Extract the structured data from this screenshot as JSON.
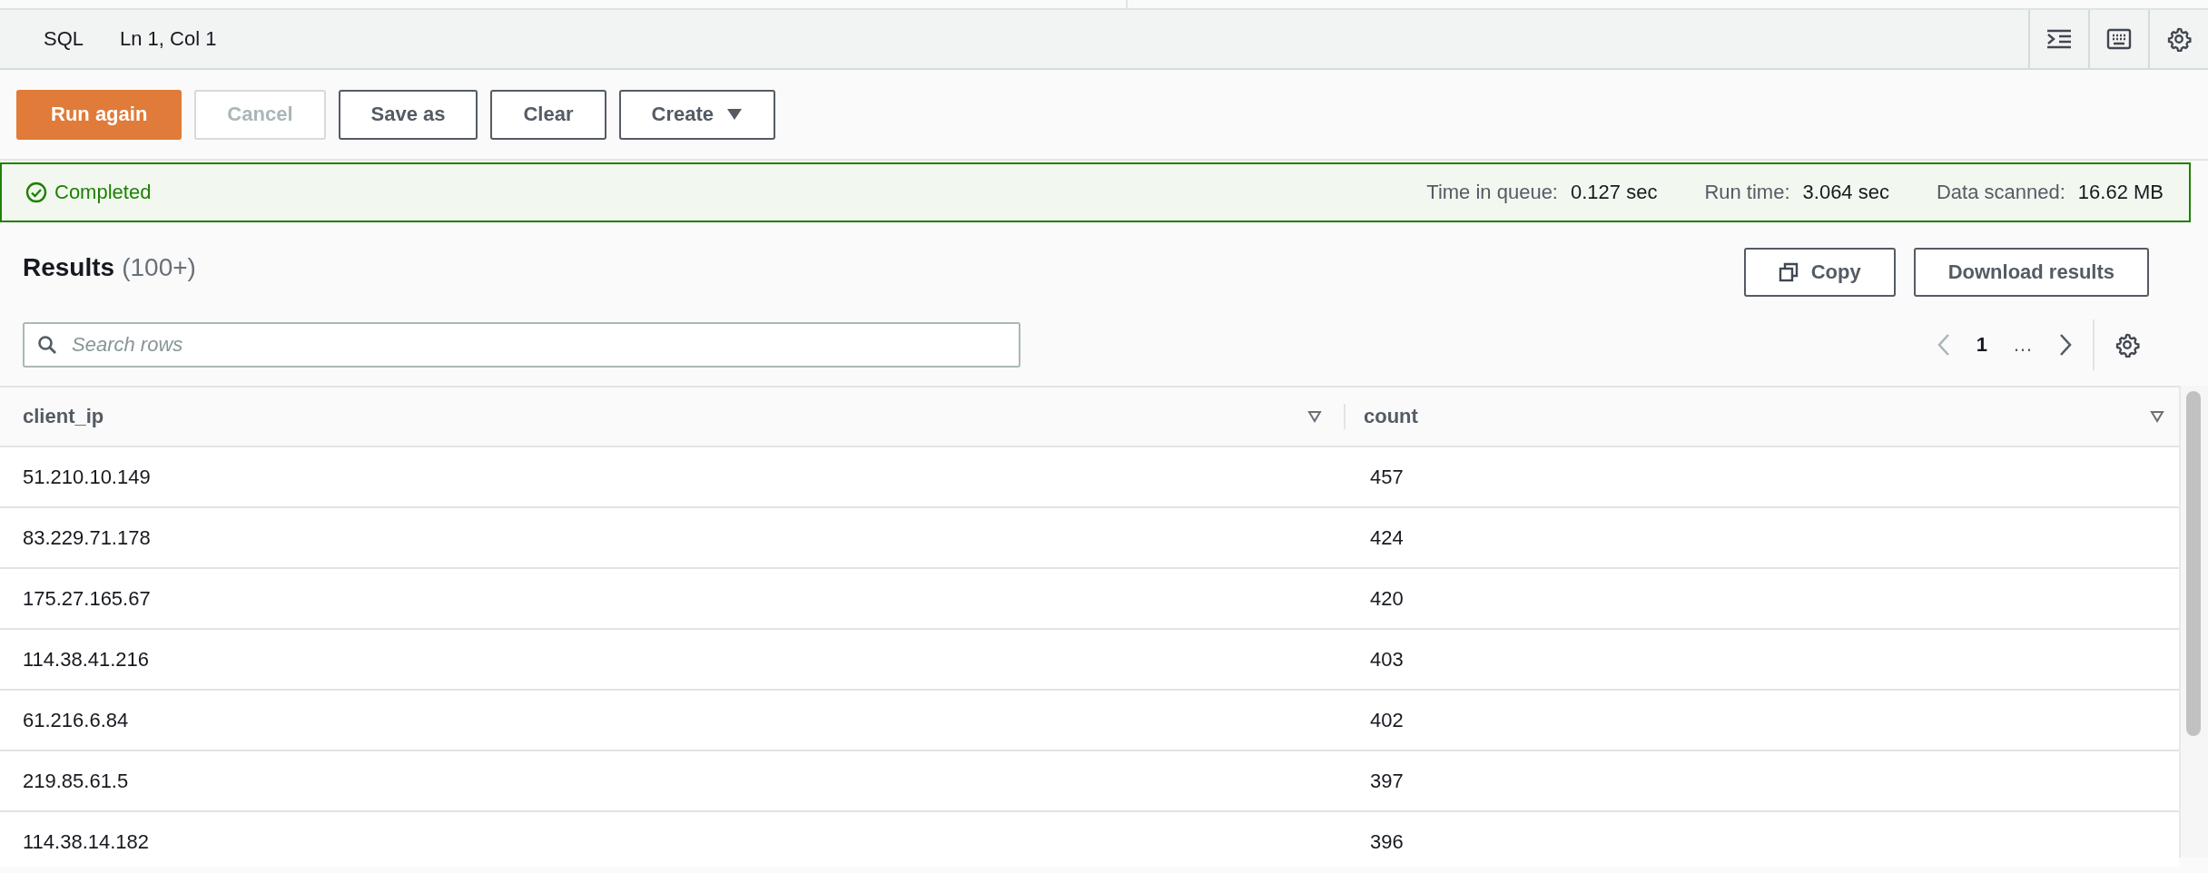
{
  "editor_status": {
    "language": "SQL",
    "cursor": "Ln 1, Col 1"
  },
  "toolbar": [
    {
      "label": "Run again",
      "kind": "primary",
      "disabled": false
    },
    {
      "label": "Cancel",
      "kind": "normal",
      "disabled": true
    },
    {
      "label": "Save as",
      "kind": "normal",
      "disabled": false
    },
    {
      "label": "Clear",
      "kind": "normal",
      "disabled": false
    },
    {
      "label": "Create",
      "kind": "dropdown",
      "disabled": false
    }
  ],
  "query_status": {
    "state": "Completed",
    "stats": [
      {
        "label": "Time in queue:",
        "value": "0.127 sec"
      },
      {
        "label": "Run time:",
        "value": "3.064 sec"
      },
      {
        "label": "Data scanned:",
        "value": "16.62 MB"
      }
    ]
  },
  "results": {
    "title": "Results",
    "count": "(100+)",
    "actions": [
      {
        "label": "Copy",
        "kind": "copy"
      },
      {
        "label": "Download results",
        "kind": "plain"
      }
    ],
    "search": {
      "placeholder": "Search rows"
    },
    "pagination": {
      "prev_disabled": true,
      "pages": [
        {
          "label": "1",
          "selected": true
        },
        {
          "label": "…",
          "selected": false
        }
      ]
    },
    "table": {
      "columns": [
        "client_ip",
        "count"
      ],
      "rows": [
        [
          "51.210.10.149",
          "457"
        ],
        [
          "83.229.71.178",
          "424"
        ],
        [
          "175.27.165.67",
          "420"
        ],
        [
          "114.38.41.216",
          "403"
        ],
        [
          "61.216.6.84",
          "402"
        ],
        [
          "219.85.61.5",
          "397"
        ],
        [
          "114.38.14.182",
          "396"
        ]
      ]
    }
  }
}
